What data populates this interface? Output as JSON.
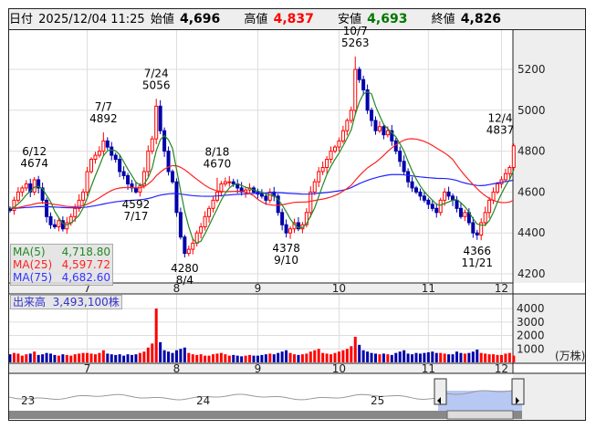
{
  "header": {
    "date_label": "日付",
    "datetime": "2025/12/04 11:25",
    "open_label": "始値",
    "open": "4,696",
    "high_label": "高値",
    "high": "4,837",
    "low_label": "安値",
    "low": "4,693",
    "close_label": "終値",
    "close": "4,826"
  },
  "legend": {
    "ma5": "MA(5)",
    "ma5_val": "4,718.80",
    "ma25": "MA(25)",
    "ma25_val": "4,597.72",
    "ma75": "MA(75)",
    "ma75_val": "4,682.60"
  },
  "volume": {
    "label": "出来高",
    "value": "3,493,100株",
    "unit": "(万株)"
  },
  "colors": {
    "up": "#ff0000",
    "down": "#0000aa",
    "ma5": "#228822",
    "ma25": "#ff2222",
    "ma75": "#2222ff",
    "nav_fill": "#b8c8f4"
  },
  "navigator": {
    "years": [
      "23",
      "24",
      "25"
    ]
  },
  "chart_data": {
    "type": "candlestick",
    "price_ticks": [
      4200,
      4400,
      4600,
      4800,
      5000,
      5200
    ],
    "ylim": [
      4200,
      5200
    ],
    "volume_ticks": [
      1000,
      2000,
      3000,
      4000
    ],
    "months": [
      {
        "label": "7",
        "index": 19
      },
      {
        "label": "8",
        "index": 41
      },
      {
        "label": "9",
        "index": 61
      },
      {
        "label": "10",
        "index": 81
      },
      {
        "label": "11",
        "index": 103
      },
      {
        "label": "12",
        "index": 121
      }
    ],
    "start_price": 4520,
    "closes": [
      4510,
      4560,
      4600,
      4620,
      4640,
      4600,
      4660,
      4620,
      4560,
      4480,
      4440,
      4430,
      4460,
      4420,
      4450,
      4480,
      4520,
      4560,
      4600,
      4700,
      4760,
      4780,
      4800,
      4850,
      4820,
      4780,
      4760,
      4700,
      4680,
      4640,
      4620,
      4600,
      4630,
      4700,
      4800,
      4860,
      5020,
      4900,
      4800,
      4700,
      4650,
      4500,
      4380,
      4300,
      4320,
      4350,
      4400,
      4430,
      4480,
      4520,
      4560,
      4600,
      4640,
      4650,
      4650,
      4640,
      4620,
      4600,
      4610,
      4620,
      4600,
      4590,
      4580,
      4560,
      4600,
      4580,
      4500,
      4440,
      4400,
      4420,
      4450,
      4420,
      4440,
      4500,
      4600,
      4650,
      4700,
      4720,
      4760,
      4800,
      4820,
      4850,
      4900,
      4950,
      5000,
      5200,
      5150,
      5100,
      5000,
      4950,
      4900,
      4920,
      4880,
      4900,
      4850,
      4800,
      4750,
      4700,
      4650,
      4620,
      4600,
      4580,
      4560,
      4540,
      4520,
      4500,
      4560,
      4600,
      4580,
      4560,
      4520,
      4480,
      4500,
      4450,
      4400,
      4390,
      4450,
      4500,
      4560,
      4600,
      4640,
      4660,
      4690,
      4720,
      4826
    ],
    "volumes": [
      600,
      700,
      650,
      500,
      600,
      650,
      800,
      550,
      600,
      700,
      650,
      550,
      500,
      600,
      550,
      500,
      600,
      650,
      700,
      700,
      650,
      600,
      700,
      900,
      650,
      600,
      550,
      600,
      500,
      600,
      550,
      600,
      700,
      800,
      1100,
      1400,
      4000,
      1500,
      900,
      800,
      700,
      900,
      1000,
      1100,
      700,
      600,
      550,
      600,
      500,
      500,
      600,
      650,
      700,
      600,
      500,
      550,
      500,
      450,
      500,
      550,
      500,
      500,
      550,
      600,
      650,
      600,
      700,
      800,
      900,
      700,
      600,
      550,
      600,
      650,
      800,
      900,
      1000,
      700,
      650,
      600,
      700,
      800,
      900,
      1000,
      1200,
      1900,
      1300,
      900,
      800,
      700,
      650,
      600,
      650,
      600,
      550,
      700,
      800,
      900,
      650,
      600,
      700,
      650,
      700,
      750,
      800,
      700,
      700,
      650,
      600,
      600,
      800,
      700,
      650,
      700,
      800,
      950,
      700,
      650,
      600,
      600,
      550,
      550,
      650,
      700,
      500
    ],
    "annotations": [
      {
        "date": "6/12",
        "value": "4674",
        "index": 6,
        "pos": "above"
      },
      {
        "date": "7/7",
        "value": "4892",
        "index": 23,
        "pos": "above"
      },
      {
        "date": "7/17",
        "value": "4592",
        "index": 31,
        "pos": "below"
      },
      {
        "date": "7/24",
        "value": "5056",
        "index": 36,
        "pos": "above"
      },
      {
        "date": "8/4",
        "value": "4280",
        "index": 43,
        "pos": "below"
      },
      {
        "date": "8/18",
        "value": "4670",
        "index": 51,
        "pos": "above"
      },
      {
        "date": "9/10",
        "value": "4378",
        "index": 68,
        "pos": "below"
      },
      {
        "date": "10/7",
        "value": "5263",
        "index": 85,
        "pos": "above"
      },
      {
        "date": "11/21",
        "value": "4366",
        "index": 115,
        "pos": "below"
      },
      {
        "date": "12/4",
        "value": "4837",
        "index": 124,
        "pos": "above"
      }
    ]
  }
}
